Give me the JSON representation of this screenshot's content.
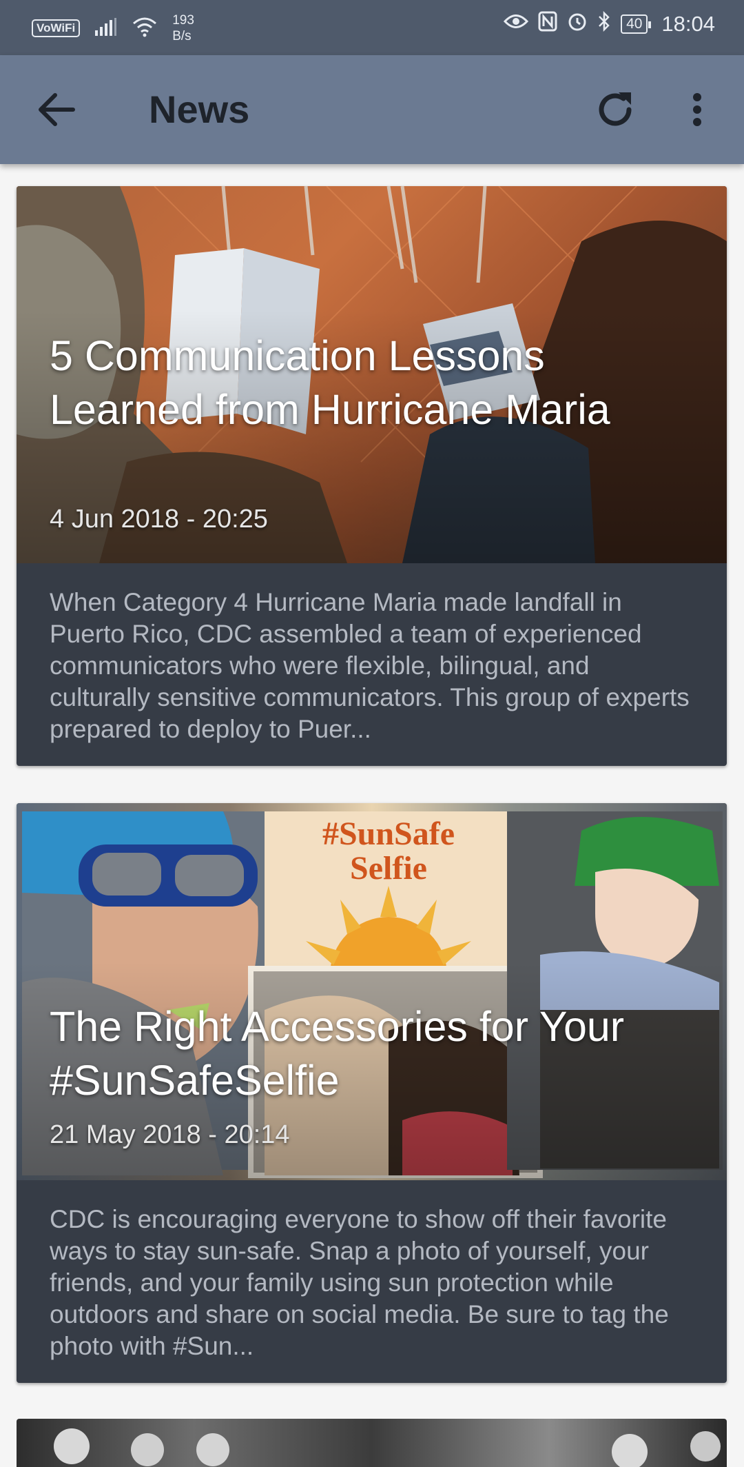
{
  "status_bar": {
    "vowifi": "VoWiFi",
    "net_speed_value": "193",
    "net_speed_unit": "B/s",
    "battery": "40",
    "time": "18:04"
  },
  "appbar": {
    "title": "News",
    "back_icon": "arrow-left-icon",
    "refresh_icon": "refresh-icon",
    "more_icon": "more-vertical-icon"
  },
  "articles": [
    {
      "title": "5 Communication Lessons Learned from Hurricane Maria",
      "date": "4 Jun 2018 - 20:25",
      "summary": "When Category 4 Hurricane Maria made landfall in Puerto Rico, CDC assembled a team of experienced communicators who were flexible, bilingual, and culturally sensitive communicators. This group of experts prepared to deploy to Puer..."
    },
    {
      "title": "The Right Accessories for Your #SunSafeSelfie",
      "date": "21 May 2018 - 20:14",
      "summary": "CDC is encouraging everyone to show off their favorite ways to stay sun-safe. Snap a photo of yourself, your friends, and your family using sun protection while outdoors and share on social media. Be sure to tag the photo with #Sun...",
      "image_text_line1": "#SunSafe",
      "image_text_line2": "Selfie"
    }
  ],
  "colors": {
    "status_bar": "#4f5a6b",
    "app_bar": "#6b7a92",
    "card_body": "#363c46",
    "background": "#f5f5f5"
  }
}
